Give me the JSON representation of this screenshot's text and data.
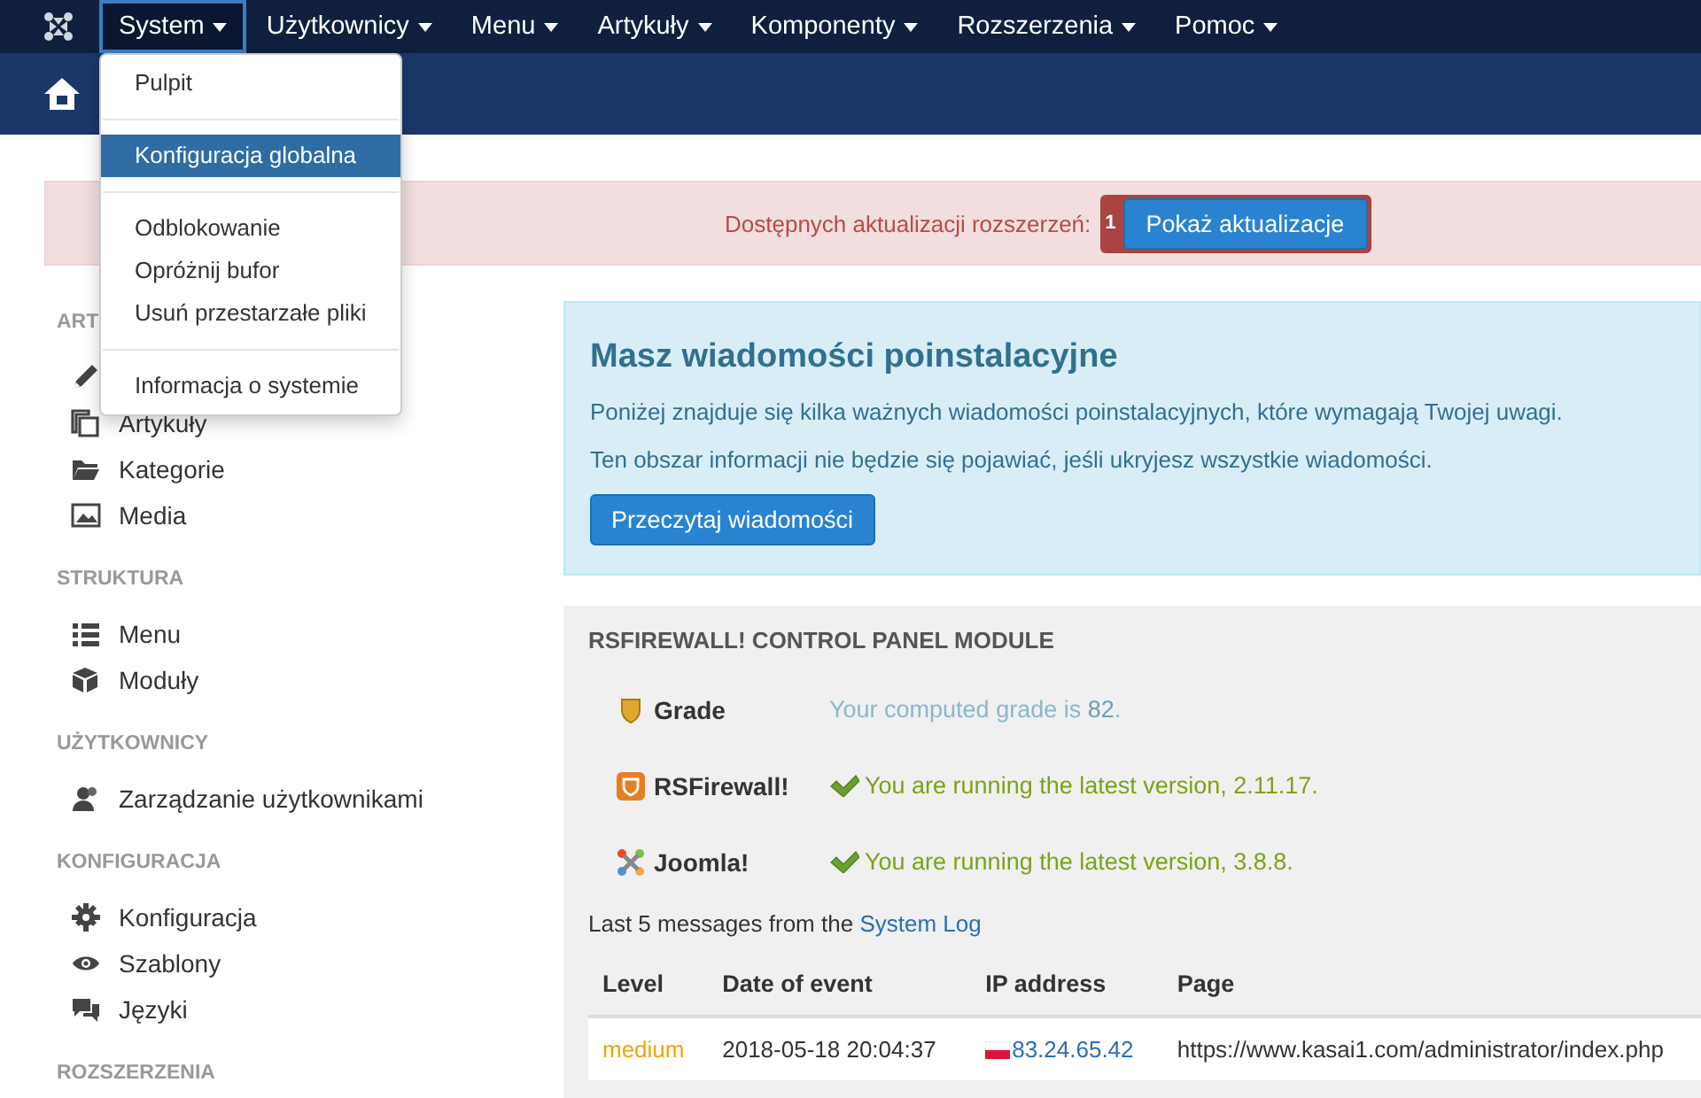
{
  "nav": {
    "items": [
      {
        "label": "System",
        "selected": true
      },
      {
        "label": "Użytkownicy",
        "selected": false
      },
      {
        "label": "Menu",
        "selected": false
      },
      {
        "label": "Artykuły",
        "selected": false
      },
      {
        "label": "Komponenty",
        "selected": false
      },
      {
        "label": "Rozszerzenia",
        "selected": false
      },
      {
        "label": "Pomoc",
        "selected": false
      }
    ]
  },
  "dropdown": {
    "groups": [
      [
        {
          "label": "Pulpit",
          "selected": false
        }
      ],
      [
        {
          "label": "Konfiguracja globalna",
          "selected": true
        }
      ],
      [
        {
          "label": "Odblokowanie",
          "selected": false
        },
        {
          "label": "Opróżnij bufor",
          "selected": false
        },
        {
          "label": "Usuń przestarzałe pliki",
          "selected": false
        }
      ],
      [
        {
          "label": "Informacja o systemie",
          "selected": false
        }
      ]
    ]
  },
  "alert": {
    "text": "Dostępnych aktualizacji rozszerzeń:",
    "badge": "1",
    "button": "Pokaż aktualizacje"
  },
  "sidebar": {
    "sections": [
      {
        "heading": "ART",
        "items": [
          {
            "kind": "icon_only"
          },
          {
            "kind": "link",
            "label": "Artykuły"
          },
          {
            "kind": "link",
            "label": "Kategorie"
          },
          {
            "kind": "link",
            "label": "Media"
          }
        ]
      },
      {
        "heading": "STRUKTURA",
        "items": [
          {
            "kind": "link",
            "label": "Menu"
          },
          {
            "kind": "link",
            "label": "Moduły"
          }
        ]
      },
      {
        "heading": "UŻYTKOWNICY",
        "items": [
          {
            "kind": "link",
            "label": "Zarządzanie użytkownikami"
          }
        ]
      },
      {
        "heading": "KONFIGURACJA",
        "items": [
          {
            "kind": "link",
            "label": "Konfiguracja"
          },
          {
            "kind": "link",
            "label": "Szablony"
          },
          {
            "kind": "link",
            "label": "Języki"
          }
        ]
      },
      {
        "heading": "ROZSZERZENIA"
      }
    ]
  },
  "postinstall": {
    "title": "Masz wiadomości poinstalacyjne",
    "lines": [
      "Poniżej znajduje się kilka ważnych wiadomości poinstalacyjnych, które wymagają Twojej uwagi.",
      "Ten obszar informacji nie będzie się pojawiać, jeśli ukryjesz wszystkie wiadomości."
    ],
    "button": "Przeczytaj wiadomości"
  },
  "module": {
    "title": "RSFIREWALL! CONTROL PANEL MODULE",
    "checks": [
      {
        "label": "Grade",
        "kind": "info",
        "text": "Your computed grade is **82**."
      },
      {
        "label": "RSFirewall!",
        "kind": "ok",
        "text": "You are running the latest version, 2.11.17."
      },
      {
        "label": "Joomla!",
        "kind": "ok",
        "text": "You are running the latest version, 3.8.8."
      }
    ],
    "log_intro": "Last 5 messages from the",
    "log_link": "System Log",
    "table": {
      "columns": [
        "Level",
        "Date of event",
        "IP address",
        "Page"
      ],
      "rows": [
        [
          "medium",
          "2018-05-18 20:04:37",
          "83.24.65.42",
          "https://www.kasai1.com/administrator/index.php"
        ]
      ]
    }
  }
}
